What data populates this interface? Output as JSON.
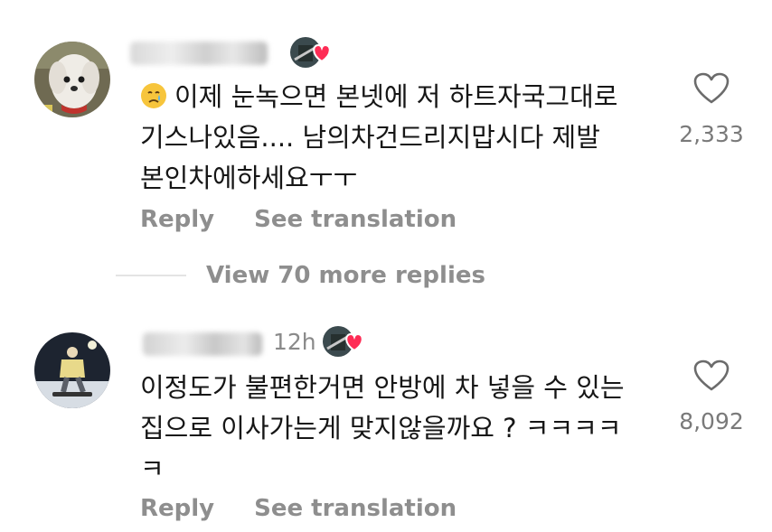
{
  "comments": [
    {
      "username_visible": "",
      "timestamp": "",
      "text_lines": [
        "이제 눈녹으면 본넷에 저 하트자국그대로",
        "기스나있음.... 남의차건드리지맙시다 제발",
        "본인차에하세요ㅜㅜ"
      ],
      "leading_emoji": "crying-face",
      "like_count": "2,333",
      "reply_label": "Reply",
      "translate_label": "See translation",
      "creator_liked": true
    },
    {
      "username_visible": "",
      "timestamp": "12h",
      "text_lines": [
        "이정도가 불편한거면 안방에 차 넣을 수 있는",
        "집으로 이사가는게 맞지않을까요 ? ㅋㅋㅋㅋ",
        "ㅋ"
      ],
      "leading_emoji": "",
      "like_count": "8,092",
      "reply_label": "Reply",
      "translate_label": "See translation",
      "creator_liked": true
    }
  ],
  "view_more_replies": "View 70 more replies",
  "colors": {
    "text": "#161616",
    "muted": "#8e8e8e",
    "heart_badge": "#fe2c55",
    "divider": "#e4e4e4"
  }
}
